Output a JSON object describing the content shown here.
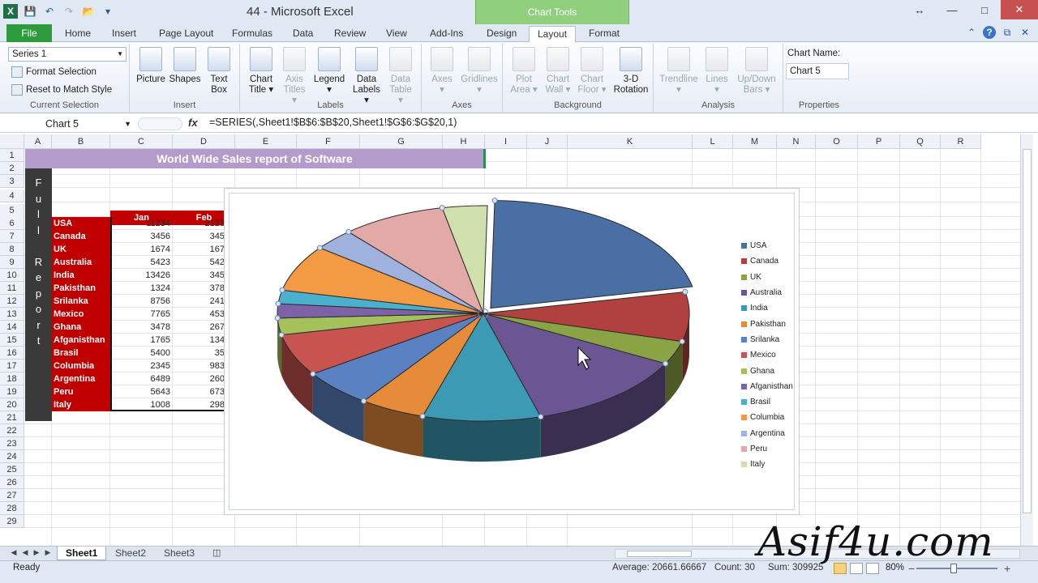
{
  "window": {
    "title": "44 - Microsoft Excel",
    "context_tab_group": "Chart Tools"
  },
  "quick_access": {
    "icons": [
      "excel-icon",
      "save-icon",
      "undo-icon",
      "redo-icon",
      "open-icon",
      "customize-icon"
    ]
  },
  "tabs": [
    "File",
    "Home",
    "Insert",
    "Page Layout",
    "Formulas",
    "Data",
    "Review",
    "View",
    "Add-Ins",
    "Design",
    "Layout",
    "Format"
  ],
  "active_tab": "Layout",
  "ribbon": {
    "current_selection": {
      "dropdown_value": "Series 1",
      "format_selection": "Format Selection",
      "reset_style": "Reset to Match Style",
      "label": "Current Selection"
    },
    "insert": {
      "picture": "Picture",
      "shapes": "Shapes",
      "text_box_1": "Text",
      "text_box_2": "Box",
      "label": "Insert"
    },
    "labels": {
      "chart_title_1": "Chart",
      "chart_title_2": "Title ▾",
      "axis_titles_1": "Axis",
      "axis_titles_2": "Titles ▾",
      "legend_1": "Legend",
      "legend_2": "▾",
      "data_labels_1": "Data",
      "data_labels_2": "Labels ▾",
      "data_table_1": "Data",
      "data_table_2": "Table ▾",
      "label": "Labels"
    },
    "axes": {
      "axes_1": "Axes",
      "axes_2": "▾",
      "gridlines_1": "Gridlines",
      "gridlines_2": "▾",
      "label": "Axes"
    },
    "background": {
      "plot_area_1": "Plot",
      "plot_area_2": "Area ▾",
      "chart_wall_1": "Chart",
      "chart_wall_2": "Wall ▾",
      "chart_floor_1": "Chart",
      "chart_floor_2": "Floor ▾",
      "rotation_1": "3-D",
      "rotation_2": "Rotation",
      "label": "Background"
    },
    "analysis": {
      "trendline_1": "Trendline",
      "trendline_2": "▾",
      "lines_1": "Lines",
      "lines_2": "▾",
      "updown_1": "Up/Down",
      "updown_2": "Bars ▾",
      "label": "Analysis"
    },
    "properties": {
      "chart_name_label": "Chart Name:",
      "chart_name_value": "Chart 5",
      "label": "Properties"
    }
  },
  "formula_bar": {
    "name_box": "Chart 5",
    "fx": "fx",
    "formula": "=SERIES(,Sheet1!$B$6:$B$20,Sheet1!$G$6:$G$20,1)"
  },
  "columns": [
    "A",
    "B",
    "C",
    "D",
    "E",
    "F",
    "G",
    "H",
    "I",
    "J",
    "K",
    "L",
    "M",
    "N",
    "O",
    "P",
    "Q",
    "R"
  ],
  "rows": [
    "1",
    "2",
    "3",
    "4",
    "5",
    "6",
    "7",
    "8",
    "9",
    "10",
    "11",
    "12",
    "13",
    "14",
    "15",
    "16",
    "17",
    "18",
    "19",
    "20",
    "21",
    "22",
    "23",
    "24",
    "25",
    "26",
    "27",
    "28",
    "29"
  ],
  "sheet": {
    "title": "World Wide Sales report of Software",
    "side_letters": [
      "F",
      "u",
      "l",
      "l",
      "",
      "R",
      "e",
      "p",
      "o",
      "r",
      "t"
    ],
    "headers": {
      "jan": "Jan",
      "feb": "Feb"
    },
    "data_rows": [
      {
        "country": "USA",
        "jan": "11234",
        "feb": "2123"
      },
      {
        "country": "Canada",
        "jan": "3456",
        "feb": "345"
      },
      {
        "country": "UK",
        "jan": "1674",
        "feb": "167"
      },
      {
        "country": "Australia",
        "jan": "5423",
        "feb": "542"
      },
      {
        "country": "India",
        "jan": "13426",
        "feb": "345"
      },
      {
        "country": "Pakisthan",
        "jan": "1324",
        "feb": "378"
      },
      {
        "country": "Srilanka",
        "jan": "8756",
        "feb": "241"
      },
      {
        "country": "Mexico",
        "jan": "7765",
        "feb": "453"
      },
      {
        "country": "Ghana",
        "jan": "3478",
        "feb": "267"
      },
      {
        "country": "Afganisthan",
        "jan": "1765",
        "feb": "134"
      },
      {
        "country": "Brasil",
        "jan": "5400",
        "feb": "35"
      },
      {
        "country": "Columbia",
        "jan": "2345",
        "feb": "983"
      },
      {
        "country": "Argentina",
        "jan": "6489",
        "feb": "260"
      },
      {
        "country": "Peru",
        "jan": "5643",
        "feb": "673"
      },
      {
        "country": "Italy",
        "jan": "1008",
        "feb": "298"
      }
    ]
  },
  "chart_data": {
    "type": "pie",
    "categories": [
      "USA",
      "Canada",
      "UK",
      "Australia",
      "India",
      "Pakisthan",
      "Srilanka",
      "Mexico",
      "Ghana",
      "Afganisthan",
      "Brasil",
      "Columbia",
      "Argentina",
      "Peru",
      "Italy"
    ],
    "values": [
      23.2,
      8.0,
      3.8,
      13.8,
      10.0,
      5.5,
      6.1,
      6.8,
      2.7,
      2.3,
      2.2,
      7.5,
      3.5,
      8.8,
      3.8
    ],
    "colors": [
      "#4a6fa5",
      "#b0413e",
      "#8aa345",
      "#6b5593",
      "#3d9ab5",
      "#e58b3a",
      "#5a82c3",
      "#c85450",
      "#a4c15c",
      "#7e62a8",
      "#4bb0cc",
      "#f39a45",
      "#9fb1dd",
      "#e3a9a7",
      "#cfe0ad"
    ],
    "legend_position": "right",
    "three_d": true
  },
  "sheet_tabs": [
    "Sheet1",
    "Sheet2",
    "Sheet3"
  ],
  "active_sheet": "Sheet1",
  "status": {
    "ready": "Ready",
    "average": "Average: 20661.66667",
    "count": "Count: 30",
    "sum": "Sum: 309925",
    "zoom": "80%"
  },
  "watermark": "Asif4u.com"
}
